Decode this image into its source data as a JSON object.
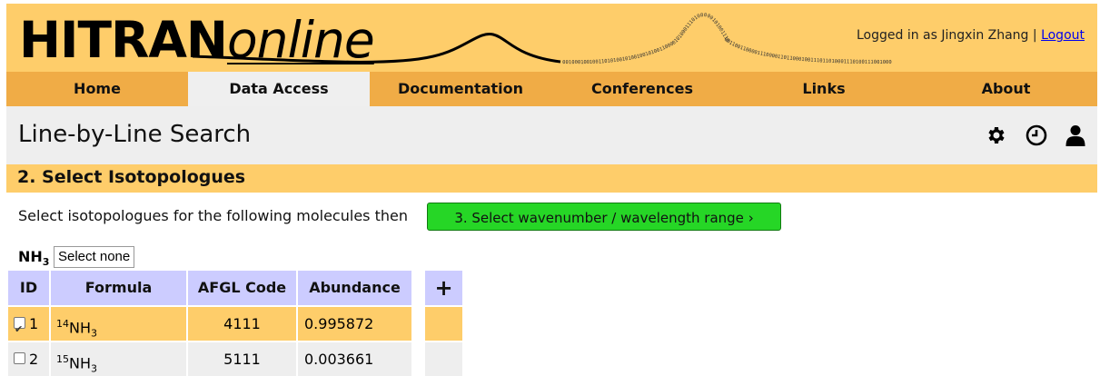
{
  "header": {
    "logo_bold": "HITRAN",
    "logo_italic": "online",
    "binary_left": "0010001001001101010010100100101001100001010001110100000101001110",
    "binary_right": "00110011000011100001101100010011101101000111010011100100011001011110",
    "login_prefix": "Logged in as Jingxin Zhang |",
    "logout_label": "Logout"
  },
  "nav": {
    "items": [
      "Home",
      "Data Access",
      "Documentation",
      "Conferences",
      "Links",
      "About"
    ],
    "active": "Data Access"
  },
  "titlebar": {
    "title": "Line-by-Line Search",
    "icons": [
      "gear-icon",
      "clock-icon",
      "user-icon"
    ]
  },
  "section": {
    "title": "2. Select Isotopologues"
  },
  "instructions": "Select isotopologues for the following molecules then",
  "next_button": "3. Select wavenumber / wavelength range",
  "molecule": {
    "name": "NH",
    "subscript": "3",
    "select_none": "Select none"
  },
  "table": {
    "headers": [
      "ID",
      "Formula",
      "AFGL Code",
      "Abundance"
    ],
    "add_column": "+",
    "rows": [
      {
        "checked": true,
        "id": "1",
        "mass": "14",
        "formula": "NH",
        "formula_sub": "3",
        "afgl": "4111",
        "abundance": "0.995872"
      },
      {
        "checked": false,
        "id": "2",
        "mass": "15",
        "formula": "NH",
        "formula_sub": "3",
        "afgl": "5111",
        "abundance": "0.003661"
      }
    ]
  },
  "colors": {
    "header_bg": "#fecd6a",
    "nav_bg": "#f0ac46",
    "active_tab_bg": "#efefef",
    "table_header_bg": "#ccccff",
    "next_button_bg": "#26d626",
    "link": "#0000ee"
  }
}
